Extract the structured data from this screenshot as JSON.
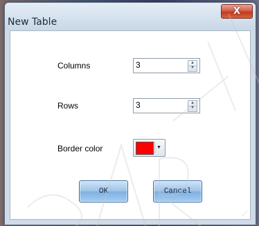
{
  "window": {
    "title": "New Table",
    "close_label": "X"
  },
  "form": {
    "columns_label": "Columns",
    "columns_value": "3",
    "rows_label": "Rows",
    "rows_value": "3",
    "border_color_label": "Border color",
    "border_color_value": "#ff0000"
  },
  "buttons": {
    "ok_label": "OK",
    "cancel_label": "Cancel"
  },
  "spin_icons": {
    "up": "▲",
    "down": "▼"
  },
  "dropdown_icon": "▼"
}
